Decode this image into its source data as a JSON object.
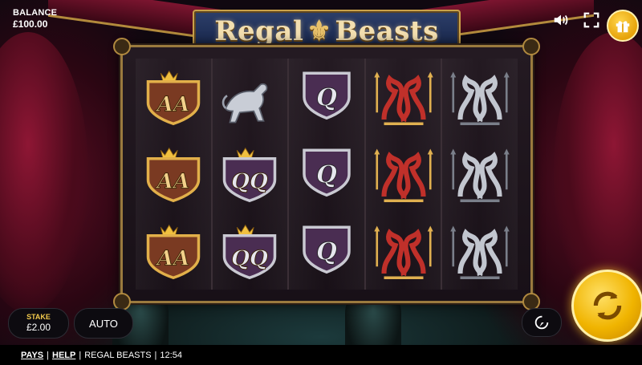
{
  "balance": {
    "label": "BALANCE",
    "value": "£100.00"
  },
  "logo": {
    "text_left": "Regal",
    "fleur": "⚜",
    "text_right": "Beasts"
  },
  "controls": {
    "stake_label": "STAKE",
    "stake_value": "£2.00",
    "auto_label": "AUTO",
    "sound_icon": "speaker-icon",
    "fullscreen_icon": "fullscreen-icon",
    "gift_icon": "gift-icon",
    "turbo_icon": "turbo-icon",
    "spin_icon": "spin-arrows-icon"
  },
  "reels": [
    [
      "AA",
      "AA",
      "AA"
    ],
    [
      "beast",
      "QQ",
      "QQ"
    ],
    [
      "Q",
      "Q",
      "Q"
    ],
    [
      "red-dragons",
      "red-dragons",
      "red-dragons"
    ],
    [
      "silver-dragons",
      "silver-dragons",
      "silver-dragons"
    ]
  ],
  "footer": {
    "pays": "PAYS",
    "help": "HELP",
    "game": "REGAL BEASTS",
    "time": "12:54"
  },
  "colors": {
    "accent_gold": "#f0b400",
    "frame_gold": "#9a7a3e",
    "curtain_red": "#8e1634"
  }
}
